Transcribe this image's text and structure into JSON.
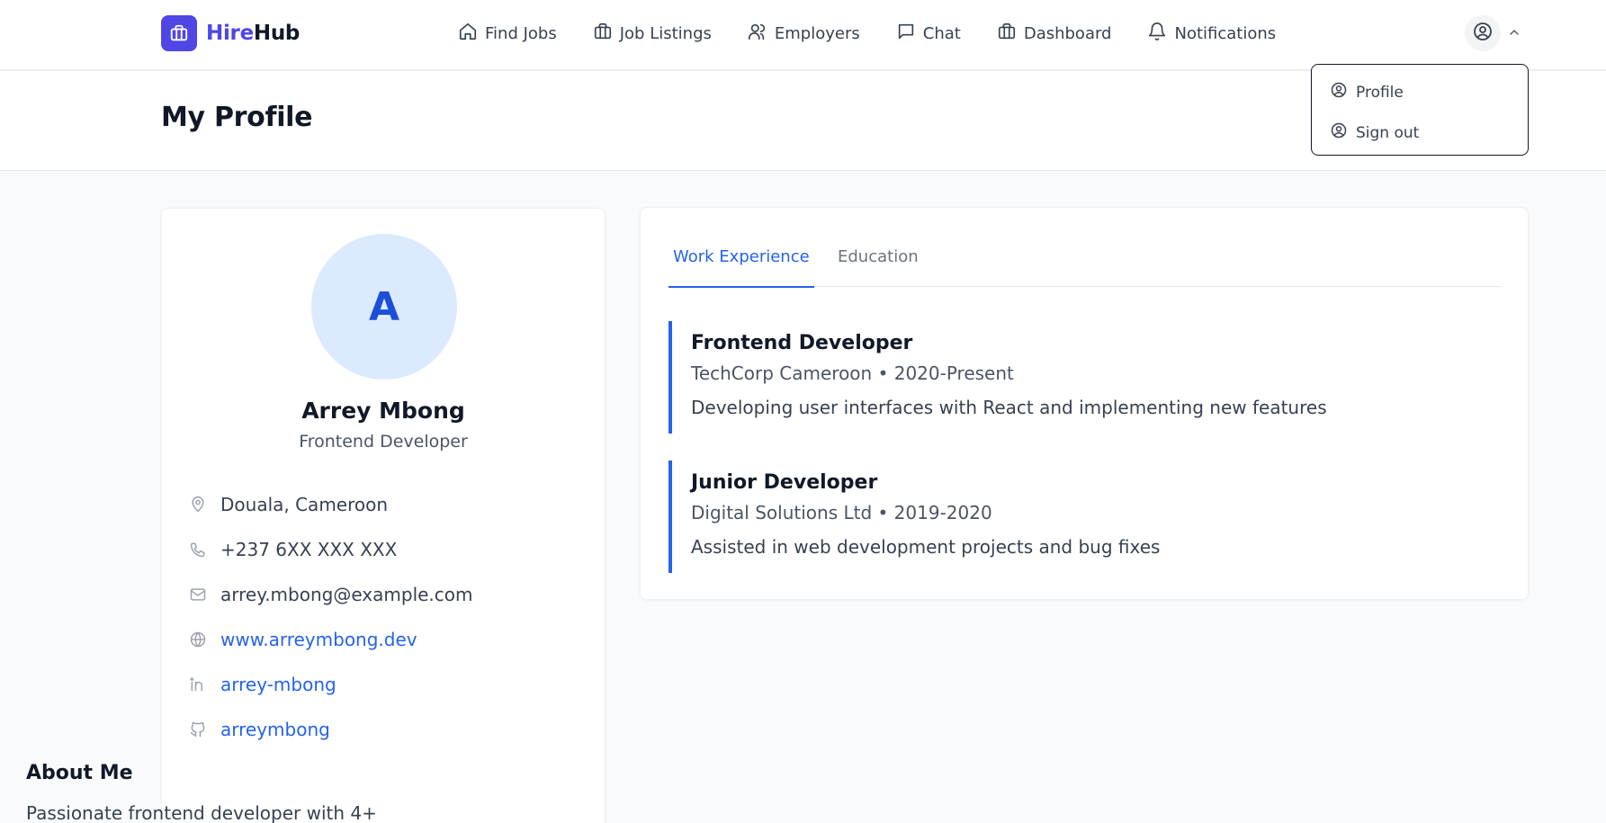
{
  "brand": {
    "name_part1": "Hire",
    "name_part2": "Hub",
    "color": "#4f46e5"
  },
  "nav": {
    "items": [
      {
        "label": "Find Jobs",
        "icon": "home-icon"
      },
      {
        "label": "Job Listings",
        "icon": "briefcase-icon"
      },
      {
        "label": "Employers",
        "icon": "users-icon"
      },
      {
        "label": "Chat",
        "icon": "chat-icon"
      },
      {
        "label": "Dashboard",
        "icon": "briefcase-icon"
      },
      {
        "label": "Notifications",
        "icon": "bell-icon"
      }
    ]
  },
  "user_menu": {
    "items": [
      {
        "label": "Profile",
        "icon": "user-circle-icon"
      },
      {
        "label": "Sign out",
        "icon": "user-circle-icon"
      }
    ]
  },
  "page": {
    "title": "My Profile"
  },
  "profile": {
    "initial": "A",
    "name": "Arrey Mbong",
    "role": "Frontend Developer",
    "location": "Douala, Cameroon",
    "phone": "+237 6XX XXX XXX",
    "email": "arrey.mbong@example.com",
    "website": "www.arreymbong.dev",
    "linkedin": "arrey-mbong",
    "github": "arreymbong",
    "about_title": "About Me",
    "about_text": "Passionate frontend developer with 4+"
  },
  "tabs": [
    {
      "label": "Work Experience",
      "active": true
    },
    {
      "label": "Education",
      "active": false
    }
  ],
  "experience": [
    {
      "title": "Frontend Developer",
      "subtitle": "TechCorp Cameroon • 2020-Present",
      "description": "Developing user interfaces with React and implementing new features"
    },
    {
      "title": "Junior Developer",
      "subtitle": "Digital Solutions Ltd • 2019-2020",
      "description": "Assisted in web development projects and bug fixes"
    }
  ],
  "colors": {
    "accent": "#2563eb",
    "avatar_bg": "#dbeafe",
    "page_bg": "#f8fafc"
  }
}
